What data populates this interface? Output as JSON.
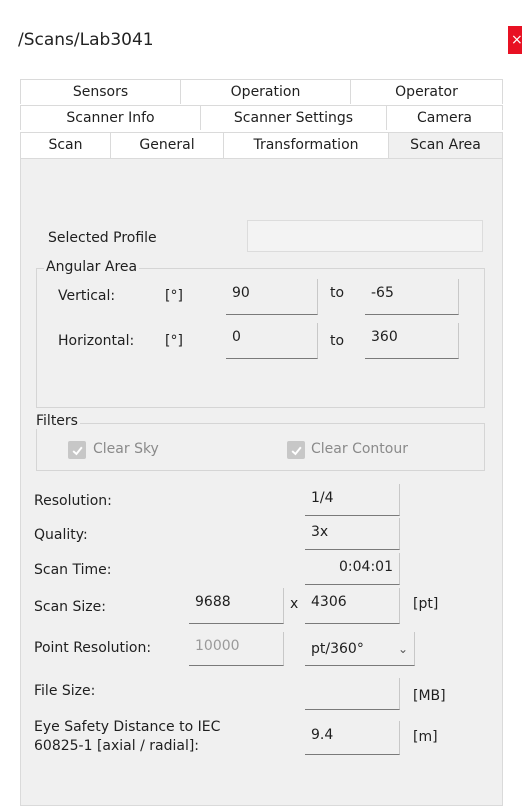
{
  "window": {
    "title": "/Scans/Lab3041",
    "close_glyph": "×"
  },
  "tabs": {
    "row1": [
      "Sensors",
      "Operation",
      "Operator"
    ],
    "row2": [
      "Scanner Info",
      "Scanner Settings",
      "Camera"
    ],
    "row3": [
      "Scan",
      "General",
      "Transformation",
      "Scan Area"
    ],
    "active": "Scan Area"
  },
  "profile": {
    "label": "Selected Profile",
    "value": ""
  },
  "angular_area": {
    "title": "Angular Area",
    "vertical": {
      "label": "Vertical:",
      "unit": "[°]",
      "from": "90",
      "to_label": "to",
      "to": "-65"
    },
    "horizontal": {
      "label": "Horizontal:",
      "unit": "[°]",
      "from": "0",
      "to_label": "to",
      "to": "360"
    }
  },
  "filters": {
    "title": "Filters",
    "clear_sky": {
      "label": "Clear Sky",
      "checked": true
    },
    "clear_contour": {
      "label": "Clear Contour",
      "checked": true
    }
  },
  "params": {
    "resolution": {
      "label": "Resolution:",
      "value": "1/4"
    },
    "quality": {
      "label": "Quality:",
      "value": "3x"
    },
    "scan_time": {
      "label": "Scan Time:",
      "value": "0:04:01"
    },
    "scan_size": {
      "label": "Scan Size:",
      "w": "9688",
      "x": "x",
      "h": "4306",
      "unit": "[pt]"
    },
    "point_resolution": {
      "label": "Point Resolution:",
      "value": "10000",
      "select": "pt/360°"
    },
    "file_size": {
      "label": "File Size:",
      "value": "",
      "unit": "[MB]"
    },
    "eye_safety": {
      "label_line1": "Eye Safety Distance to IEC",
      "label_line2": "60825-1 [axial / radial]:",
      "value": "9.4",
      "unit": "[m]"
    }
  },
  "colors": {
    "panel": "#f0f0f0",
    "close": "#e81123",
    "border": "#dadada"
  }
}
